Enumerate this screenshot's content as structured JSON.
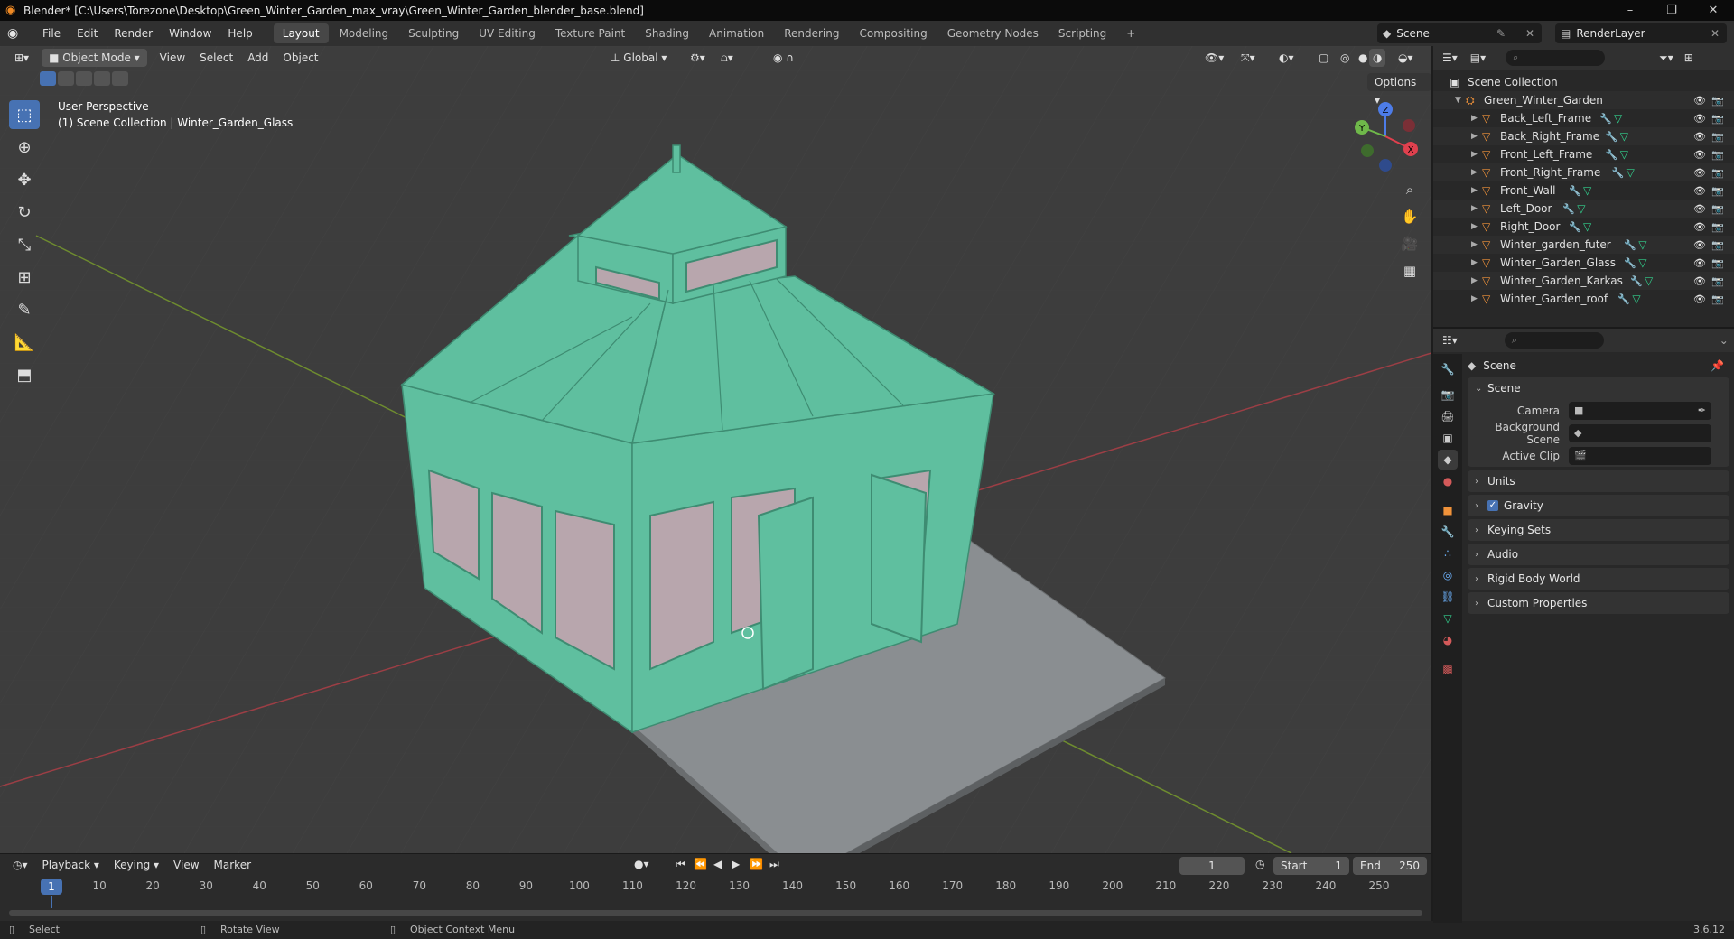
{
  "window": {
    "title": "Blender* [C:\\Users\\Torezone\\Desktop\\Green_Winter_Garden_max_vray\\Green_Winter_Garden_blender_base.blend]",
    "minimize": "–",
    "restore": "❐",
    "close": "✕"
  },
  "menu": [
    "File",
    "Edit",
    "Render",
    "Window",
    "Help"
  ],
  "workspaces": [
    "Layout",
    "Modeling",
    "Sculpting",
    "UV Editing",
    "Texture Paint",
    "Shading",
    "Animation",
    "Rendering",
    "Compositing",
    "Geometry Nodes",
    "Scripting"
  ],
  "add_workspace": "+",
  "scene_selector": "Scene",
  "view_layer": "RenderLayer",
  "viewport": {
    "mode": "Object Mode",
    "menus": [
      "View",
      "Select",
      "Add",
      "Object"
    ],
    "orientation": "Global",
    "options": "Options",
    "perspective": "User Perspective",
    "context": "(1) Scene Collection | Winter_Garden_Glass",
    "gizmo": {
      "x": "X",
      "y": "Y",
      "z": "Z"
    }
  },
  "outliner": {
    "root": "Scene Collection",
    "collection": "Green_Winter_Garden",
    "objects": [
      "Back_Left_Frame",
      "Back_Right_Frame",
      "Front_Left_Frame",
      "Front_Right_Frame",
      "Front_Wall",
      "Left_Door",
      "Right_Door",
      "Winter_garden_futer",
      "Winter_Garden_Glass",
      "Winter_Garden_Karkas",
      "Winter_Garden_roof"
    ]
  },
  "properties": {
    "context_title": "Scene",
    "panel_scene": "Scene",
    "camera_label": "Camera",
    "background_scene_label": "Background Scene",
    "active_clip_label": "Active Clip",
    "collapsed_panels": [
      "Units",
      "Gravity",
      "Keying Sets",
      "Audio",
      "Rigid Body World",
      "Custom Properties"
    ]
  },
  "timeline": {
    "menus": [
      "Playback",
      "Keying",
      "View",
      "Marker"
    ],
    "current_frame": "1",
    "start_label": "Start",
    "start": "1",
    "end_label": "End",
    "end": "250",
    "ticks": [
      "10",
      "20",
      "30",
      "40",
      "50",
      "60",
      "70",
      "80",
      "90",
      "100",
      "110",
      "120",
      "130",
      "140",
      "150",
      "160",
      "170",
      "180",
      "190",
      "200",
      "210",
      "220",
      "230",
      "240",
      "250"
    ]
  },
  "status": {
    "select": "Select",
    "rotate": "Rotate View",
    "context_menu": "Object Context Menu",
    "version": "3.6.12"
  },
  "colors": {
    "accent": "#4772b3",
    "object_icon": "#f0923a",
    "mesh_icon": "#32d18e",
    "modifier_icon": "#6eb4ff",
    "model": "#5fbf9f"
  }
}
